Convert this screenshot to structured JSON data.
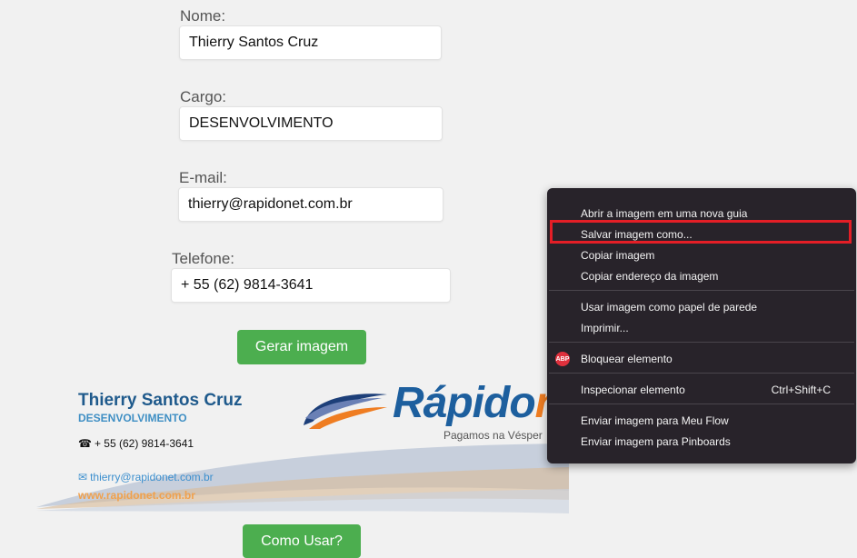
{
  "form": {
    "name_label": "Nome:",
    "name_value": "Thierry Santos Cruz",
    "role_label": "Cargo:",
    "role_value": "DESENVOLVIMENTO",
    "email_label": "E-mail:",
    "email_value": "thierry@rapidonet.com.br",
    "phone_label": "Telefone:",
    "phone_value": "+ 55 (62) 9814-3641",
    "generate_button": "Gerar imagem",
    "howto_button": "Como Usar?"
  },
  "signature": {
    "name": "Thierry Santos Cruz",
    "role": "DESENVOLVIMENTO",
    "phone_icon": "phone-icon",
    "phone": "+ 55 (62) 9814-3641",
    "email_icon": "envelope-icon",
    "email": "thierry@rapidonet.com.br",
    "website": "www.rapidonet.com.br",
    "logo_main": "Rápido",
    "logo_tail": "ne",
    "logo_slogan": "Pagamos na Vésper"
  },
  "context_menu": {
    "items": [
      {
        "label": "Abrir a imagem em uma nova guia",
        "shortcut": ""
      },
      {
        "label": "Salvar imagem como...",
        "shortcut": ""
      },
      {
        "label": "Copiar imagem",
        "shortcut": ""
      },
      {
        "label": "Copiar endereço da imagem",
        "shortcut": ""
      },
      {
        "label": "Usar imagem como papel de parede",
        "shortcut": ""
      },
      {
        "label": "Imprimir...",
        "shortcut": ""
      },
      {
        "label": "Bloquear elemento",
        "shortcut": "",
        "icon_text": "ABP"
      },
      {
        "label": "Inspecionar elemento",
        "shortcut": "Ctrl+Shift+C"
      },
      {
        "label": "Enviar imagem para Meu Flow",
        "shortcut": ""
      },
      {
        "label": "Enviar imagem para Pinboards",
        "shortcut": ""
      }
    ],
    "highlight_color": "#e41e26"
  },
  "colors": {
    "button_green": "#4cae4f",
    "brand_blue": "#1d5f9e",
    "brand_orange": "#ef7d22",
    "menu_bg": "#28232a"
  }
}
